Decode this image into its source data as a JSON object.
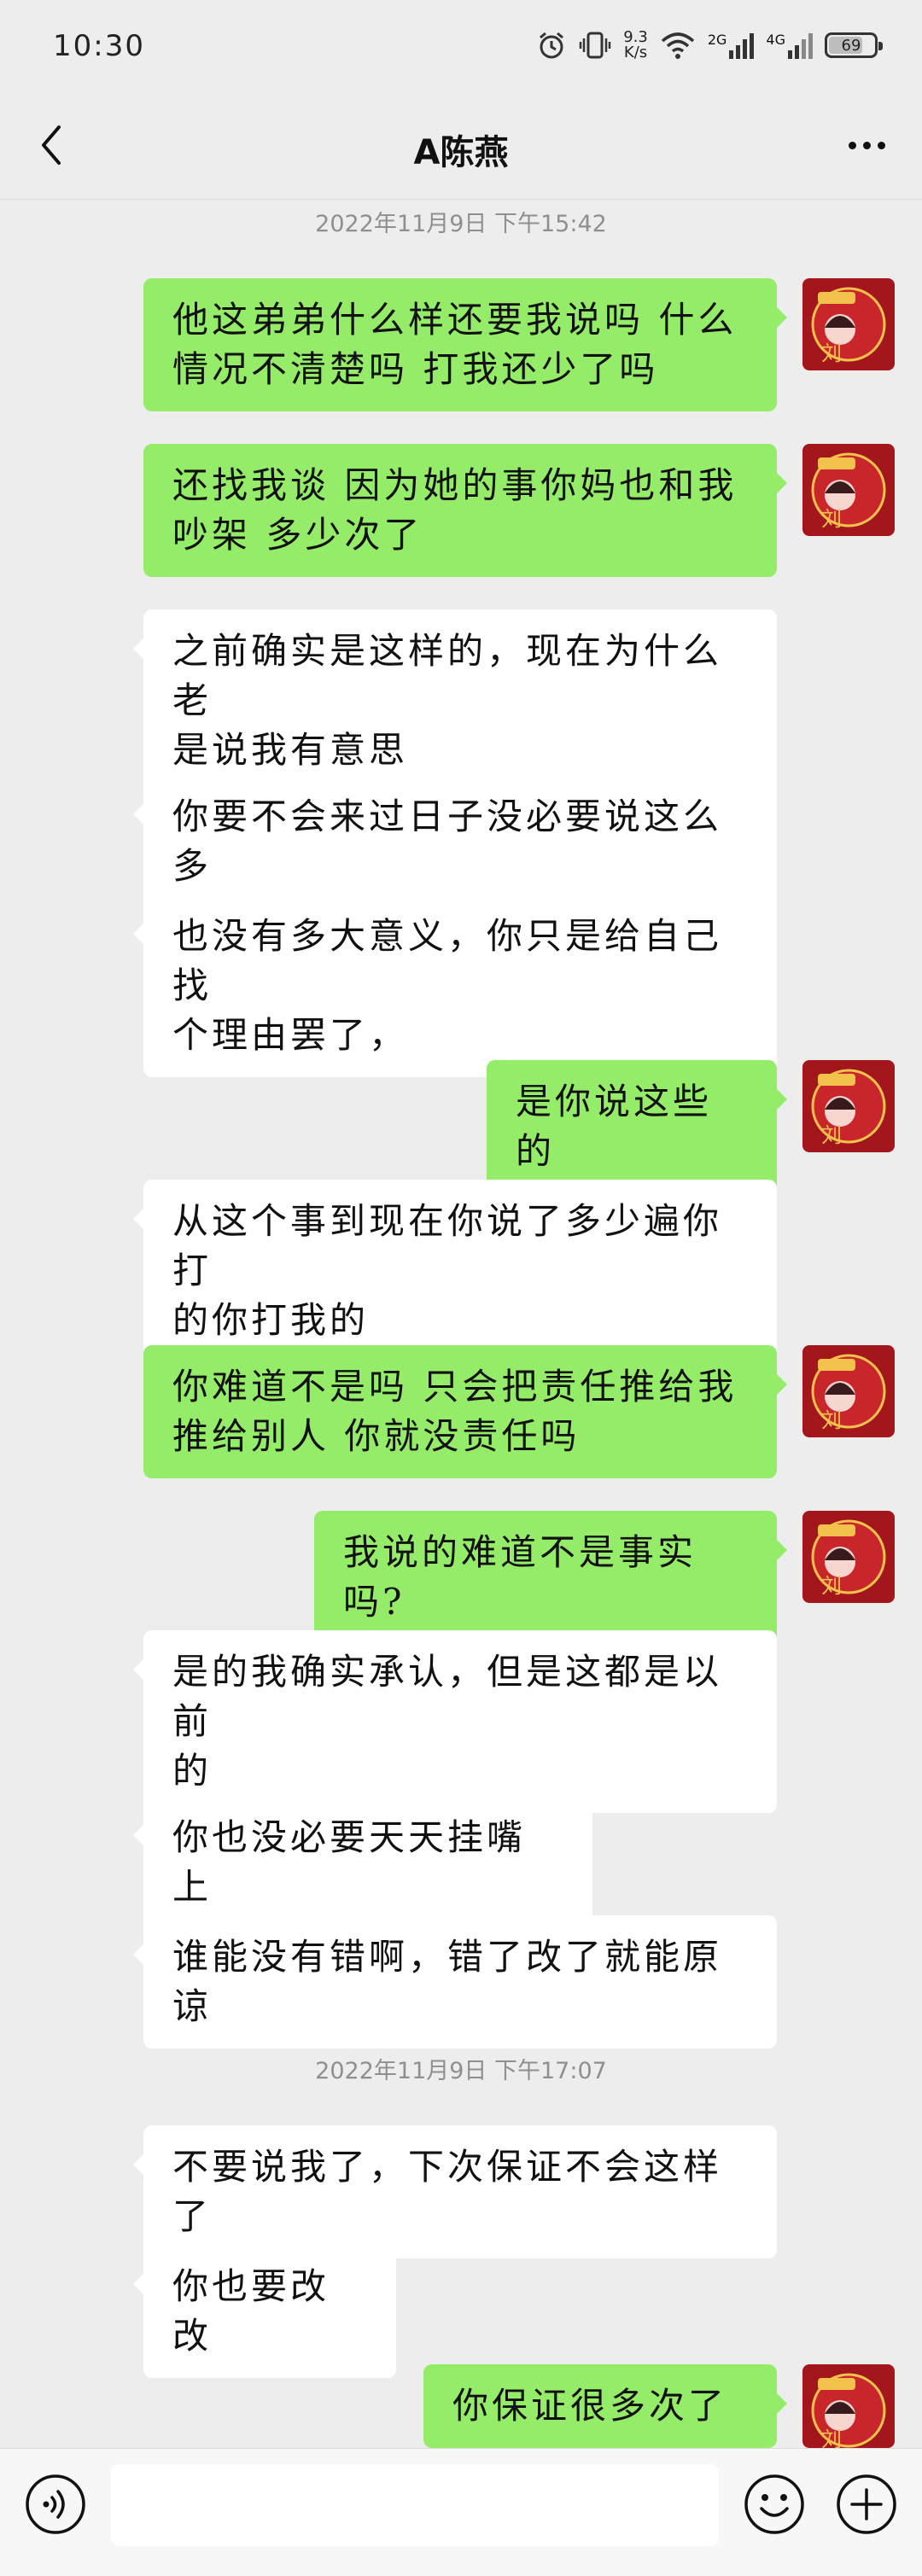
{
  "status_bar": {
    "time": "10:30",
    "speed_value": "9.3",
    "speed_unit": "K/s",
    "net1": "2G",
    "net2": "4G",
    "battery": "69"
  },
  "header": {
    "title": "A陈燕"
  },
  "colors": {
    "sent_bubble": "#95ec69",
    "recv_bubble": "#ffffff",
    "background": "#ededed"
  },
  "timestamps": [
    "2022年11月9日 下午15:42",
    "2022年11月9日 下午17:07"
  ],
  "messages": [
    {
      "side": "sent",
      "lines": [
        "他这弟弟什么样还要我说吗 什么",
        "情况不清楚吗 打我还少了吗"
      ]
    },
    {
      "side": "sent",
      "lines": [
        "还找我谈 因为她的事你妈也和我",
        "吵架 多少次了"
      ]
    },
    {
      "side": "recv",
      "lines": [
        "之前确实是这样的，现在为什么老",
        "是说我有意思"
      ]
    },
    {
      "side": "recv",
      "lines": [
        "你要不会来过日子没必要说这么多"
      ]
    },
    {
      "side": "recv",
      "lines": [
        "也没有多大意义，你只是给自己找",
        "个理由罢了，"
      ]
    },
    {
      "side": "sent",
      "lines": [
        "是你说这些的"
      ]
    },
    {
      "side": "recv",
      "lines": [
        "从这个事到现在你说了多少遍你打",
        "的你打我的"
      ]
    },
    {
      "side": "sent",
      "lines": [
        "你难道不是吗 只会把责任推给我",
        "推给别人 你就没责任吗"
      ]
    },
    {
      "side": "sent",
      "lines": [
        "我说的难道不是事实吗?"
      ]
    },
    {
      "side": "recv",
      "lines": [
        "是的我确实承认，但是这都是以前",
        "的"
      ]
    },
    {
      "side": "recv",
      "lines": [
        "你也没必要天天挂嘴上"
      ]
    },
    {
      "side": "recv",
      "lines": [
        "谁能没有错啊，错了改了就能原谅"
      ]
    },
    {
      "side": "recv",
      "lines": [
        "不要说我了，下次保证不会这样了"
      ]
    },
    {
      "side": "recv",
      "lines": [
        "你也要改改"
      ]
    },
    {
      "side": "sent",
      "lines": [
        "你保证很多次了"
      ]
    }
  ],
  "input": {
    "voice_icon": "voice-icon",
    "emoji_icon": "emoji-icon",
    "plus_icon": "plus-icon"
  }
}
